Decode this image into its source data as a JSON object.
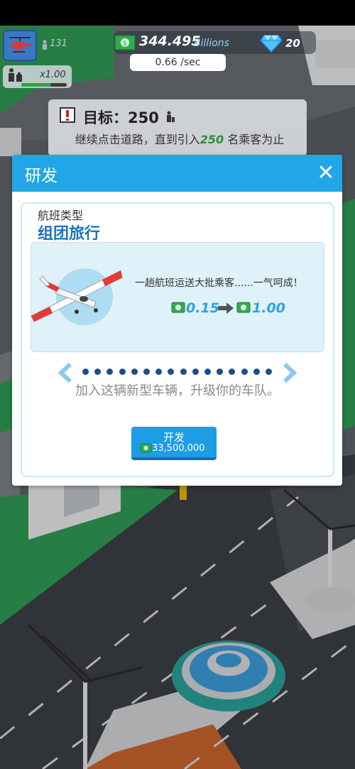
{
  "hud": {
    "passenger_count": "131",
    "money_amount": "344.495",
    "money_unit": "Billions",
    "income_rate": "0.66 /sec",
    "gems": "20",
    "multiplier": "x1.00",
    "multiplier_progress": 0.66,
    "icons": {
      "vehicle": "helicopter-icon",
      "passenger": "passenger-icon",
      "cash": "cash-icon",
      "gem": "diamond-icon",
      "alert": "alert-icon"
    }
  },
  "goal": {
    "title": "目标：250",
    "desc_pre": "继续点击道路，直到引入",
    "desc_num": "250",
    "desc_post": "名乘客为止"
  },
  "dialog": {
    "title": "研发",
    "close_label": "✕",
    "type_label": "航班类型",
    "type_value": "组团旅行",
    "card_desc": "一趟航班运送大批乘客......一气呵成！",
    "rate_old": "0.15",
    "rate_new": "1.00",
    "dot_count": 16,
    "upgrade_text": "加入这辆新型车辆，升级你的车队。",
    "build_label": "开发",
    "build_price": "33,500,000"
  },
  "colors": {
    "header_blue": "#23a6e8",
    "title_blue": "#1e74b8",
    "cash_green": "#2fae4e",
    "rate_blue": "#2aa4e6"
  }
}
